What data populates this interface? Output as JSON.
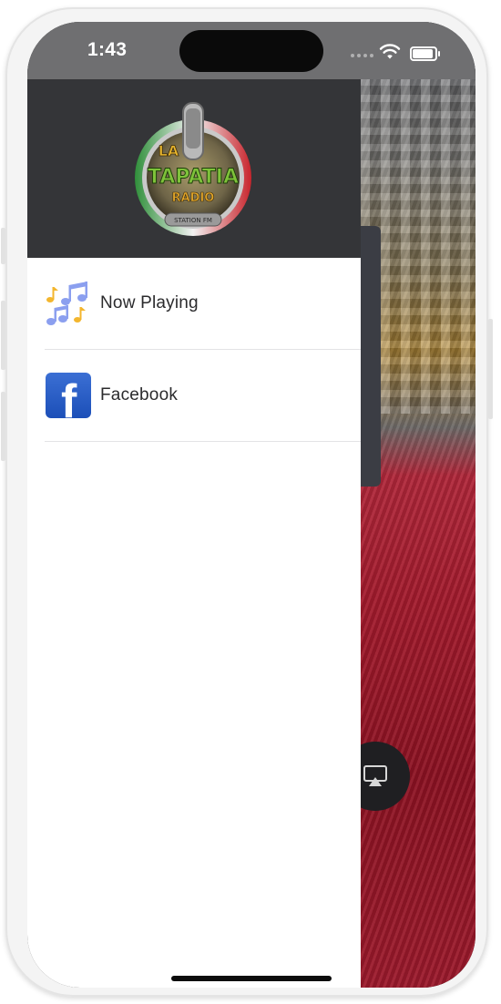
{
  "status_bar": {
    "time": "1:43"
  },
  "drawer": {
    "logo": {
      "text_top": "LA",
      "text_main": "TAPATIA",
      "text_sub": "RADIO",
      "text_badge": "STATION FM"
    },
    "menu": [
      {
        "label": "Now Playing",
        "icon": "music-notes-icon"
      },
      {
        "label": "Facebook",
        "icon": "facebook-icon"
      }
    ]
  },
  "colors": {
    "status_bar": "#6f6f71",
    "drawer_header": "#343538",
    "menu_text": "#2b2b2d",
    "facebook_blue": "#1c4fb8"
  }
}
